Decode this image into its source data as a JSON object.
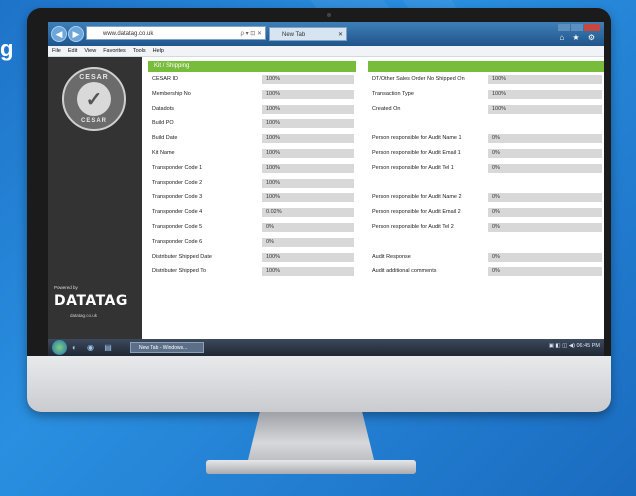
{
  "side_text": "g",
  "browser": {
    "address": "www.datatag.co.uk",
    "address_icons": "ρ ▾ ⊡ ✕",
    "tab_title": "New Tab",
    "tab_close": "✕",
    "back_glyph": "◀",
    "forward_glyph": "▶",
    "toolbar_icons": "⌂ ★ ⚙",
    "menu": [
      "File",
      "Edit",
      "View",
      "Favorites",
      "Tools",
      "Help"
    ]
  },
  "sidebar": {
    "seal_top": "CESAR",
    "seal_bottom": "CESAR",
    "seal_icon": "✓",
    "powered_by": "Powered by",
    "logo": "DATATAG",
    "logo_url": "datatag.co.uk"
  },
  "left_panel": {
    "header": "Kit / Shipping",
    "rows": [
      {
        "label": "CESAR ID",
        "value": "100%"
      },
      {
        "label": "Membership No",
        "value": "100%"
      },
      {
        "label": "Datadots",
        "value": "100%"
      },
      {
        "label": "Build PO",
        "value": "100%"
      },
      {
        "label": "Build Date",
        "value": "100%"
      },
      {
        "label": "Kit Name",
        "value": "100%"
      },
      {
        "label": "Transponder Code 1",
        "value": "100%"
      },
      {
        "label": "Transponder Code 2",
        "value": "100%"
      },
      {
        "label": "Transponder Code 3",
        "value": "100%"
      },
      {
        "label": "Transponder Code 4",
        "value": "0.02%"
      },
      {
        "label": "Transponder Code 5",
        "value": "0%"
      },
      {
        "label": "Transponder Code 6",
        "value": "0%"
      },
      {
        "label": "Distributer Shipped Date",
        "value": "100%"
      },
      {
        "label": "Distributer Shipped To",
        "value": "100%"
      }
    ]
  },
  "right_panel": {
    "header": "",
    "rows": [
      {
        "label": "DT/Other Sales Order No Shipped On",
        "value": "100%"
      },
      {
        "label": "Transaction Type",
        "value": "100%"
      },
      {
        "label": "Created On",
        "value": "100%"
      },
      {
        "label": "",
        "value": ""
      },
      {
        "label": "Person responsible for Audit Name 1",
        "value": "0%"
      },
      {
        "label": "Person responsible for Audit Email 1",
        "value": "0%"
      },
      {
        "label": "Person responsible for Audit Tel 1",
        "value": "0%"
      },
      {
        "label": "",
        "value": ""
      },
      {
        "label": "Person responsible for Audit Name 2",
        "value": "0%"
      },
      {
        "label": "Person responsible for Audit Email 2",
        "value": "0%"
      },
      {
        "label": "Person responsible for Audit Tel 2",
        "value": "0%"
      },
      {
        "label": "",
        "value": ""
      },
      {
        "label": "Audit Response",
        "value": "0%"
      },
      {
        "label": "Audit additional comments",
        "value": "0%"
      }
    ]
  },
  "taskbar": {
    "quick_launch": "◐ ◉ ▤",
    "task_label": "New Tab - Windows...",
    "tray": "▣ ◧ ◫ ◀) 06:45 PM"
  },
  "colors": {
    "accent_green": "#78bc3c",
    "background_blue": "#1e73c8"
  }
}
